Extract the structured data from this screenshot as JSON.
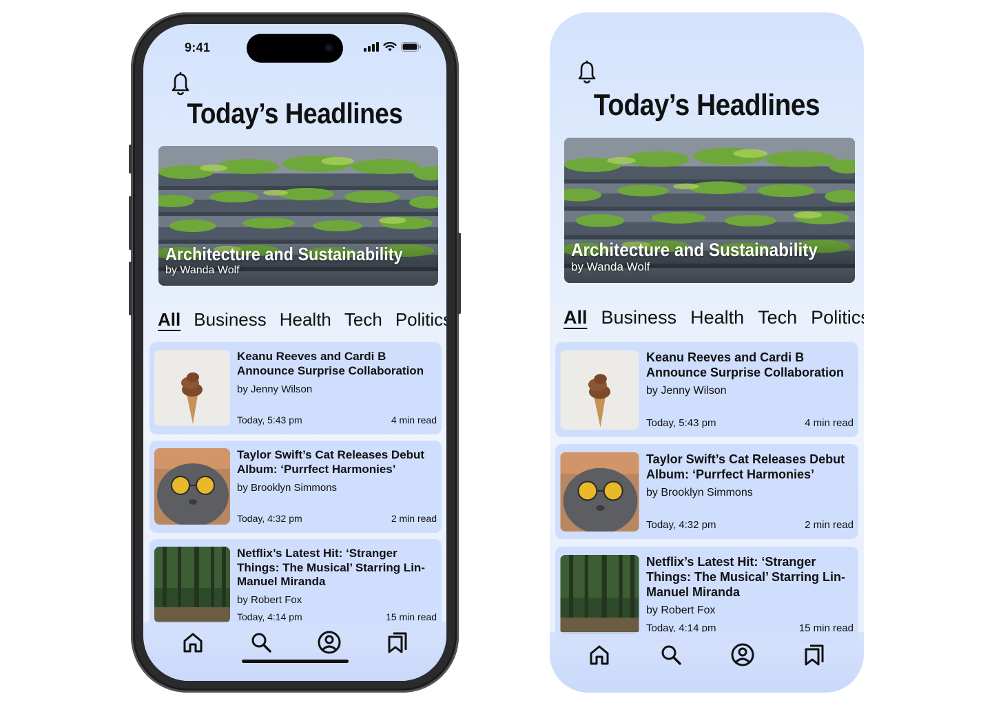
{
  "status": {
    "time": "9:41"
  },
  "header": {
    "title": "Today’s Headlines"
  },
  "hero": {
    "title": "Architecture and Sustainability",
    "author": "by Wanda Wolf"
  },
  "tabs": [
    "All",
    "Business",
    "Health",
    "Tech",
    "Politics"
  ],
  "articles": [
    {
      "title": "Keanu Reeves and Cardi B Announce Surprise Collaboration",
      "author": "by Jenny Wilson",
      "date": "Today, 5:43 pm",
      "read": "4 min read",
      "thumb": "ice-cream-cone"
    },
    {
      "title": "Taylor Swift’s Cat Releases Debut Album: ‘Purrfect Harmonies’",
      "author": "by Brooklyn Simmons",
      "date": "Today, 4:32 pm",
      "read": "2 min read",
      "thumb": "cat-with-sunglasses"
    },
    {
      "title": "Netflix’s Latest Hit: ‘Stranger Things: The Musical’ Starring Lin-Manuel Miranda",
      "author": "by Robert Fox",
      "date": "Today, 4:14 pm",
      "read": "15 min read",
      "thumb": "forest"
    }
  ],
  "nav": {
    "items": [
      "home-icon",
      "search-icon",
      "profile-icon",
      "bookmarks-icon"
    ]
  },
  "colors": {
    "card": "#cfdefd",
    "background": "#dfe9fd",
    "text": "#111111"
  }
}
